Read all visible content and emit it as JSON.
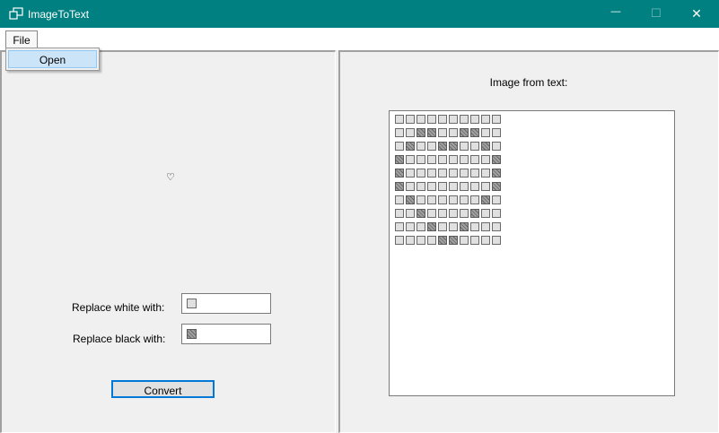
{
  "window": {
    "title": "ImageToText",
    "minimize_glyph": "—",
    "maximize_glyph": "☐",
    "close_glyph": "✕"
  },
  "menu": {
    "file_label": "File",
    "open_label": "Open"
  },
  "left": {
    "source_image_glyph": "♡",
    "replace_white_label": "Replace white with:",
    "replace_black_label": "Replace black with:",
    "white_replacement_icon": "light-square-icon",
    "black_replacement_icon": "hatched-square-icon",
    "convert_label": "Convert"
  },
  "right": {
    "preview_label": "Image from text:",
    "grid_rows": [
      "WWWWWWWWWW",
      "WWBBWWBBWW",
      "WBWWBBWWBW",
      "BWWWWWWWWB",
      "BWWWWWWWWB",
      "BWWWWWWWWB",
      "WBWWWWWWBW",
      "WWBWWWWBWW",
      "WWWBWWBWWW",
      "WWWWBBWWWW"
    ]
  },
  "colors": {
    "titlebar": "#008080",
    "accent_border": "#0078d7",
    "menu_highlight": "#cce4f7"
  }
}
